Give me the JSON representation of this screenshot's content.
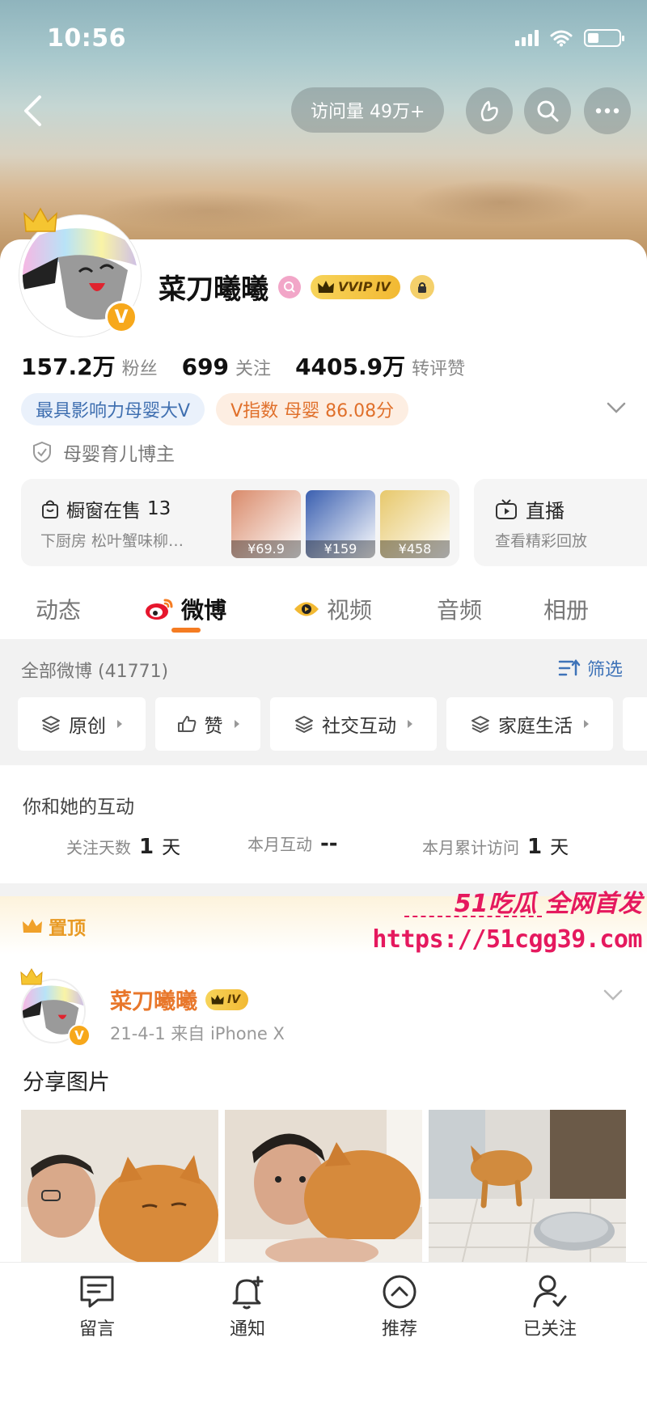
{
  "status_bar": {
    "time": "10:56",
    "battery_level": 0.35
  },
  "header": {
    "visits_label": "访问量 49万+"
  },
  "profile": {
    "name": "菜刀曦曦",
    "vip_badge": "VVIP",
    "vip_level": "IV",
    "verified_mark": "V",
    "stats": [
      {
        "value": "157.2万",
        "label": "粉丝"
      },
      {
        "value": "699",
        "label": "关注"
      },
      {
        "value": "4405.9万",
        "label": "转评赞"
      }
    ],
    "tags": [
      {
        "text": "最具影响力母婴大V"
      },
      {
        "text": "V指数 母婴 86.08分"
      }
    ],
    "certification": "母婴育儿博主"
  },
  "shop": {
    "title": "橱窗在售",
    "count": "13",
    "subtitle": "下厨房 松叶蟹味柳…",
    "products": [
      {
        "price": "¥69.9",
        "color": "#d98a6a"
      },
      {
        "price": "¥159",
        "color": "#3a5fb0"
      },
      {
        "price": "¥458",
        "color": "#e7c86b"
      }
    ]
  },
  "live": {
    "title": "直播",
    "subtitle": "查看精彩回放"
  },
  "tabs": [
    {
      "label": "动态"
    },
    {
      "label": "微博"
    },
    {
      "label": "视频"
    },
    {
      "label": "音频"
    },
    {
      "label": "相册"
    }
  ],
  "filter": {
    "all_label": "全部微博 (41771)",
    "filter_label": "筛选",
    "chips": [
      {
        "label": "原创"
      },
      {
        "label": "赞"
      },
      {
        "label": "社交互动"
      },
      {
        "label": "家庭生活"
      }
    ]
  },
  "interaction": {
    "title": "你和她的互动",
    "items": [
      {
        "label": "关注天数",
        "value": "1",
        "unit": "天"
      },
      {
        "label": "本月互动",
        "value": "--",
        "unit": ""
      },
      {
        "label": "本月累计访问",
        "value": "1",
        "unit": "天"
      }
    ]
  },
  "post": {
    "pinned_label": "置顶",
    "author": "菜刀曦曦",
    "author_level": "IV",
    "meta": "21-4-1  来自 iPhone X",
    "text": "分享图片"
  },
  "watermark": {
    "line1": "51吃瓜 全网首发",
    "url": "https://51cgg39.com"
  },
  "bottom_nav": [
    {
      "label": "留言"
    },
    {
      "label": "通知"
    },
    {
      "label": "推荐"
    },
    {
      "label": "已关注"
    }
  ],
  "colors": {
    "accent": "#f57c22",
    "link_blue": "#3e73b8",
    "brand_pink": "#e5195e",
    "vip_gold": "#f2b933"
  }
}
